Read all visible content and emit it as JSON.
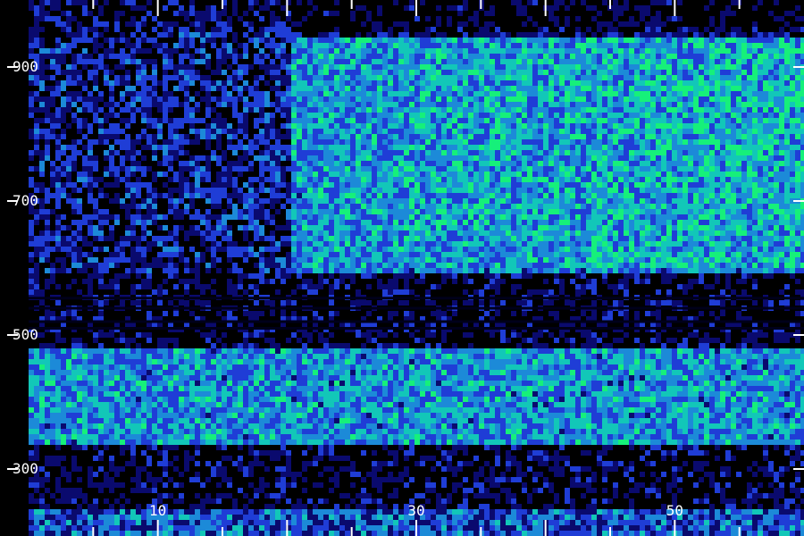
{
  "chart_data": {
    "type": "heatmap",
    "title": "",
    "xlabel": "",
    "ylabel": "",
    "x_tick_labels": [
      "10",
      "30",
      "50"
    ],
    "x_tick_values": [
      10,
      30,
      50
    ],
    "y_tick_labels": [
      "300",
      "500",
      "700",
      "900"
    ],
    "y_tick_values": [
      300,
      500,
      700,
      900
    ],
    "xlim": [
      0,
      60
    ],
    "ylim": [
      200,
      1000
    ],
    "colormap": [
      "#000000",
      "#0a0a6e",
      "#1f3dd6",
      "#1c8ad8",
      "#12c7b8",
      "#16f07a"
    ],
    "intensity_regions": [
      {
        "x": [
          0,
          20
        ],
        "y": [
          600,
          1000
        ],
        "level": 0.25
      },
      {
        "x": [
          20,
          60
        ],
        "y": [
          600,
          950
        ],
        "level": 0.55
      },
      {
        "x": [
          0,
          60
        ],
        "y": [
          340,
          480
        ],
        "level": 0.6
      },
      {
        "x": [
          0,
          60
        ],
        "y": [
          280,
          330
        ],
        "level": 0.1
      },
      {
        "x": [
          0,
          60
        ],
        "y": [
          200,
          240
        ],
        "level": 0.45
      }
    ],
    "dark_lines_y": [
      510,
      520,
      540,
      555
    ],
    "grid": false
  }
}
